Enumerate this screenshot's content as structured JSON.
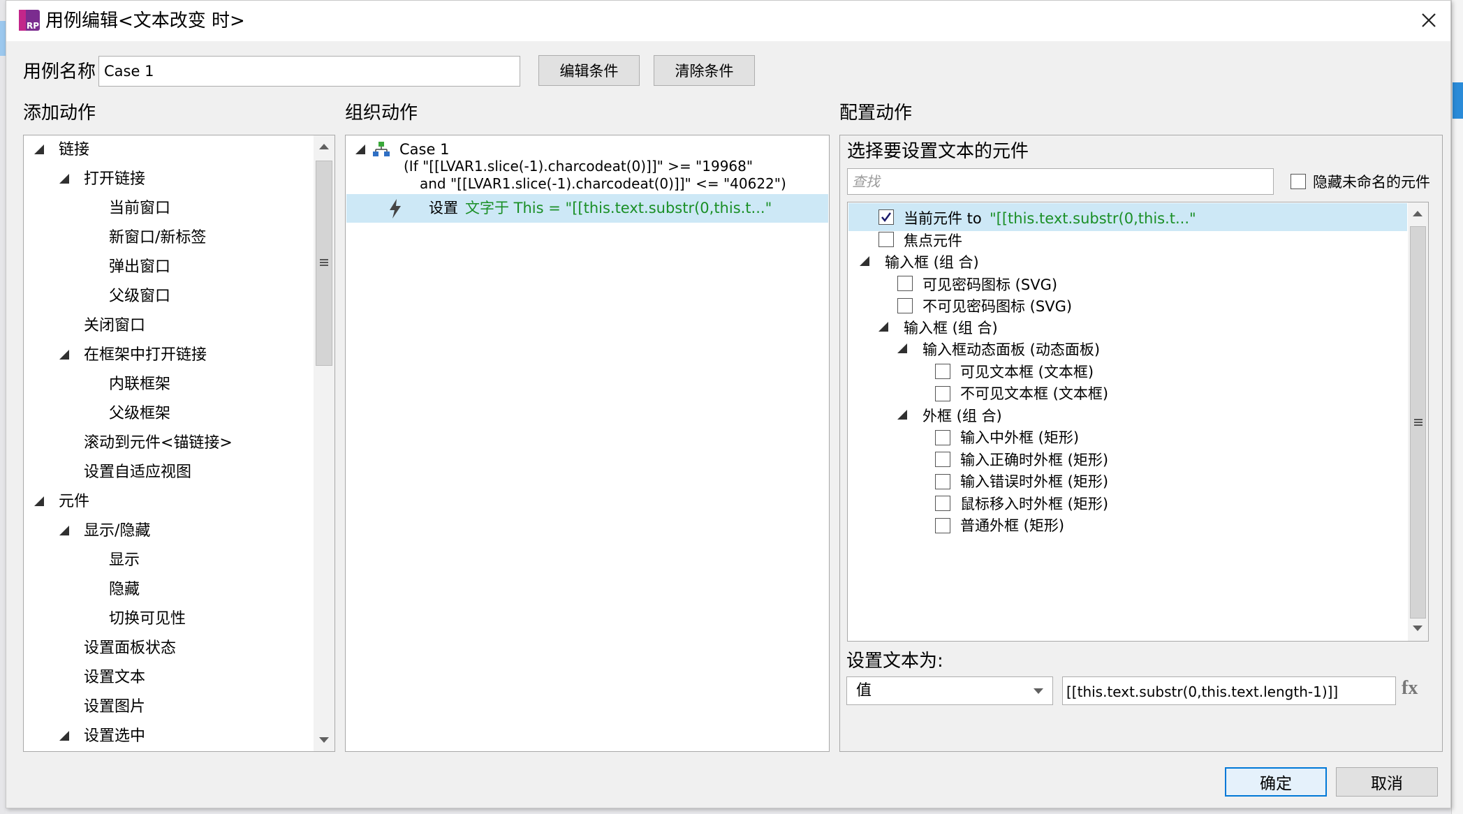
{
  "dialog": {
    "title": "用例编辑<文本改变 时>",
    "logo_text": "RP",
    "close_icon": "close-icon"
  },
  "case_name": {
    "label": "用例名称",
    "value": "Case 1",
    "edit_condition": "编辑条件",
    "clear_condition": "清除条件"
  },
  "add_action": {
    "header": "添加动作",
    "tree": [
      {
        "label": "链接"
      },
      {
        "label": "打开链接"
      },
      {
        "label": "当前窗口"
      },
      {
        "label": "新窗口/新标签"
      },
      {
        "label": "弹出窗口"
      },
      {
        "label": "父级窗口"
      },
      {
        "label": "关闭窗口"
      },
      {
        "label": "在框架中打开链接"
      },
      {
        "label": "内联框架"
      },
      {
        "label": "父级框架"
      },
      {
        "label": "滚动到元件<锚链接>"
      },
      {
        "label": "设置自适应视图"
      },
      {
        "label": "元件"
      },
      {
        "label": "显示/隐藏"
      },
      {
        "label": "显示"
      },
      {
        "label": "隐藏"
      },
      {
        "label": "切换可见性"
      },
      {
        "label": "设置面板状态"
      },
      {
        "label": "设置文本"
      },
      {
        "label": "设置图片"
      },
      {
        "label": "设置选中"
      }
    ]
  },
  "organize": {
    "header": "组织动作",
    "case_label": "Case 1",
    "condition_line1": "(If \"[[LVAR1.slice(-1).charcodeat(0)]]\" >= \"19968\"",
    "condition_line2": "and \"[[LVAR1.slice(-1).charcodeat(0)]]\" <= \"40622\")",
    "action_prefix": "设置",
    "action_detail": "文字于 This = \"[[this.text.substr(0,this.t...\""
  },
  "configure": {
    "header": "配置动作",
    "select_title": "选择要设置文本的元件",
    "search_placeholder": "查找",
    "hide_unnamed": "隐藏未命名的元件",
    "tree": [
      {
        "label": "当前元件",
        "suffix": " to ",
        "value": "\"[[this.text.substr(0,this.t...\"",
        "checked": true
      },
      {
        "label": "焦点元件",
        "checked": false
      },
      {
        "label": "输入框 (组 合)"
      },
      {
        "label": "可见密码图标 (SVG)",
        "checked": false
      },
      {
        "label": "不可见密码图标 (SVG)",
        "checked": false
      },
      {
        "label": "输入框 (组 合)"
      },
      {
        "label": "输入框动态面板 (动态面板)"
      },
      {
        "label": "可见文本框 (文本框)",
        "checked": false
      },
      {
        "label": "不可见文本框 (文本框)",
        "checked": false
      },
      {
        "label": "外框 (组 合)"
      },
      {
        "label": "输入中外框 (矩形)",
        "checked": false
      },
      {
        "label": "输入正确时外框 (矩形)",
        "checked": false
      },
      {
        "label": "输入错误时外框 (矩形)",
        "checked": false
      },
      {
        "label": "鼠标移入时外框 (矩形)",
        "checked": false
      },
      {
        "label": "普通外框 (矩形)",
        "checked": false
      }
    ],
    "set_text_label": "设置文本为:",
    "value_type": "值",
    "value_text": "[[this.text.substr(0,this.text.length-1)]]",
    "fx": "fx"
  },
  "footer": {
    "ok": "确定",
    "cancel": "取消"
  }
}
